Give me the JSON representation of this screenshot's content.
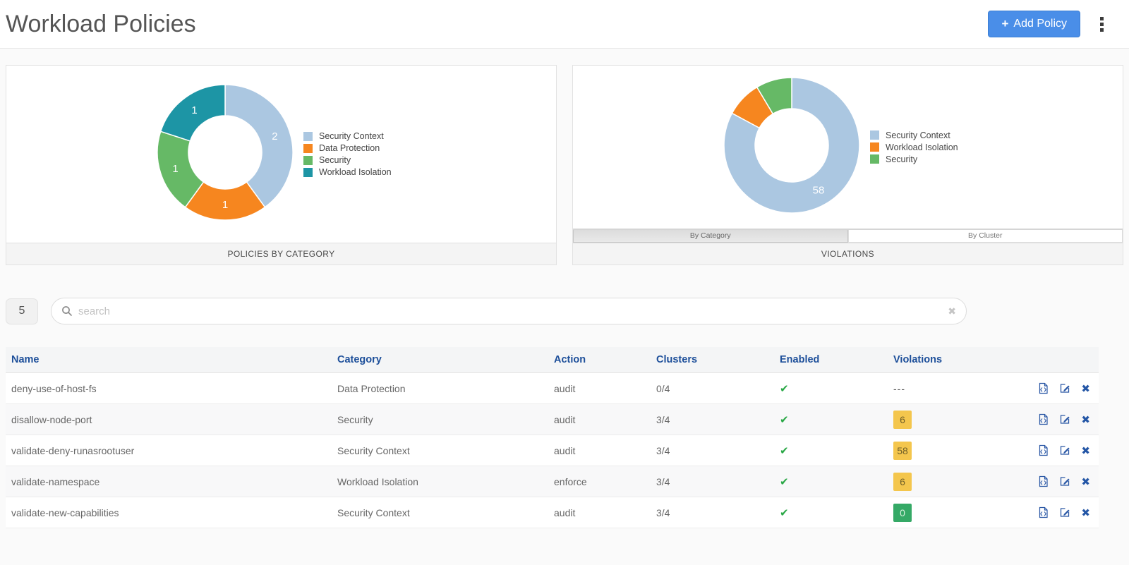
{
  "header": {
    "title": "Workload Policies",
    "add_policy": {
      "plus": "+",
      "label": "Add Policy"
    },
    "kebab_icon": "kebab-menu-icon"
  },
  "colors": {
    "accent_blue": "#4a8ee8",
    "table_header_text": "#1d4f9a",
    "check_green": "#28a745",
    "badge_warning_bg": "#f4c64d",
    "badge_ok_bg": "#35a966",
    "slice_security_context": "#abc7e1",
    "slice_orange": "#f6861f",
    "slice_green": "#66b966",
    "slice_teal": "#1d95a5"
  },
  "chart_data": [
    {
      "type": "pie",
      "donut": true,
      "title": "POLICIES BY CATEGORY",
      "labels": [
        "Security Context",
        "Data Protection",
        "Security",
        "Workload Isolation"
      ],
      "values": [
        2,
        1,
        1,
        1
      ],
      "colors": [
        "#abc7e1",
        "#f6861f",
        "#66b966",
        "#1d95a5"
      ],
      "legend_position": "right",
      "slice_labels_shown": [
        "2",
        "1",
        "1",
        "1"
      ]
    },
    {
      "type": "pie",
      "donut": true,
      "title": "VIOLATIONS",
      "subtitle": "By Category",
      "labels": [
        "Security Context",
        "Workload Isolation",
        "Security"
      ],
      "values": [
        58,
        6,
        6
      ],
      "colors": [
        "#abc7e1",
        "#f6861f",
        "#66b966"
      ],
      "legend_position": "right",
      "slice_labels_shown": [
        "58"
      ]
    }
  ],
  "panels": {
    "left": {
      "footer": "POLICIES BY CATEGORY"
    },
    "right": {
      "footer": "VIOLATIONS",
      "tabs": [
        {
          "label": "By Category",
          "active": true
        },
        {
          "label": "By Cluster",
          "active": false
        }
      ]
    }
  },
  "search": {
    "count": "5",
    "placeholder": "search",
    "value": "",
    "search_icon": "search-icon",
    "clear_icon": "clear-icon",
    "clear_glyph": "✖"
  },
  "table": {
    "columns": [
      "Name",
      "Category",
      "Action",
      "Clusters",
      "Enabled",
      "Violations"
    ],
    "row_action_icons": [
      "yaml-file-icon",
      "edit-icon",
      "delete-icon"
    ],
    "enabled_glyph": "✔",
    "rows": [
      {
        "name": "deny-use-of-host-fs",
        "category": "Data Protection",
        "action": "audit",
        "clusters": "0/4",
        "enabled": true,
        "violations": "---",
        "violations_style": "none"
      },
      {
        "name": "disallow-node-port",
        "category": "Security",
        "action": "audit",
        "clusters": "3/4",
        "enabled": true,
        "violations": "6",
        "violations_style": "warning"
      },
      {
        "name": "validate-deny-runasrootuser",
        "category": "Security Context",
        "action": "audit",
        "clusters": "3/4",
        "enabled": true,
        "violations": "58",
        "violations_style": "warning"
      },
      {
        "name": "validate-namespace",
        "category": "Workload Isolation",
        "action": "enforce",
        "clusters": "3/4",
        "enabled": true,
        "violations": "6",
        "violations_style": "warning"
      },
      {
        "name": "validate-new-capabilities",
        "category": "Security Context",
        "action": "audit",
        "clusters": "3/4",
        "enabled": true,
        "violations": "0",
        "violations_style": "ok"
      }
    ]
  }
}
